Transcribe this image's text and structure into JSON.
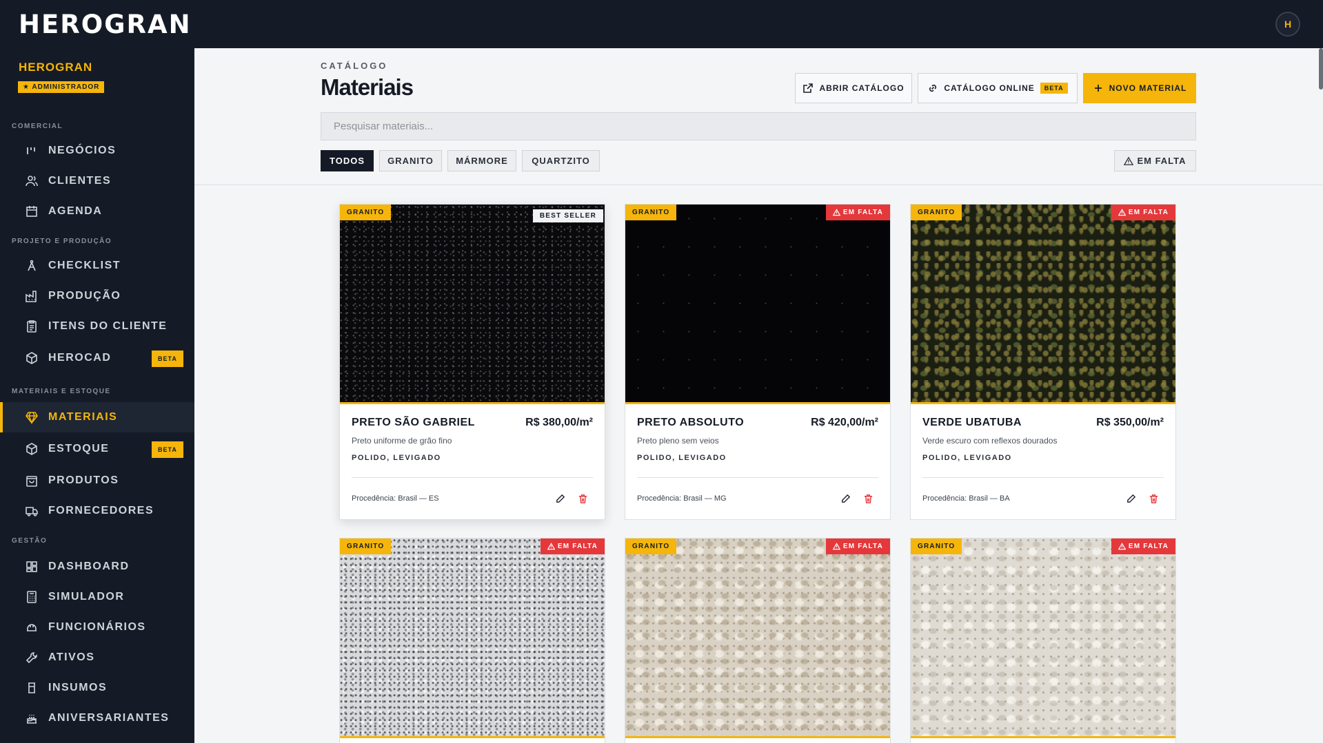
{
  "app": {
    "logo": "HEROGRAN",
    "avatar_initial": "H"
  },
  "sidebar": {
    "org_name": "HEROGRAN",
    "role": "★ ADMINISTRADOR",
    "sections": {
      "comercial": "COMERCIAL",
      "projeto": "PROJETO E PRODUÇÃO",
      "materiais": "MATERIAIS E ESTOQUE",
      "gestao": "GESTÃO"
    },
    "items": [
      {
        "label": "NEGÓCIOS",
        "icon": "chart-bars-icon"
      },
      {
        "label": "CLIENTES",
        "icon": "users-icon"
      },
      {
        "label": "AGENDA",
        "icon": "calendar-icon"
      },
      {
        "label": "CHECKLIST",
        "icon": "compass-icon"
      },
      {
        "label": "PRODUÇÃO",
        "icon": "factory-icon"
      },
      {
        "label": "ITENS DO CLIENTE",
        "icon": "clipboard-icon"
      },
      {
        "label": "HEROCAD",
        "icon": "box-icon",
        "badge": "BETA"
      },
      {
        "label": "MATERIAIS",
        "icon": "gem-icon"
      },
      {
        "label": "ESTOQUE",
        "icon": "box-icon",
        "badge": "BETA"
      },
      {
        "label": "PRODUTOS",
        "icon": "shopping-bag-icon"
      },
      {
        "label": "FORNECEDORES",
        "icon": "truck-icon"
      },
      {
        "label": "DASHBOARD",
        "icon": "dashboard-icon"
      },
      {
        "label": "SIMULADOR",
        "icon": "calculator-icon"
      },
      {
        "label": "FUNCIONÁRIOS",
        "icon": "hard-hat-icon"
      },
      {
        "label": "ATIVOS",
        "icon": "wrench-icon"
      },
      {
        "label": "INSUMOS",
        "icon": "cylinder-icon"
      },
      {
        "label": "ANIVERSARIANTES",
        "icon": "cake-icon"
      }
    ],
    "active_item": "MATERIAIS"
  },
  "header": {
    "eyebrow": "CATÁLOGO",
    "title": "Materiais",
    "btn_open_catalog": "ABRIR CATÁLOGO",
    "btn_online_catalog": "CATÁLOGO ONLINE",
    "btn_online_badge": "BETA",
    "btn_new_material": "NOVO MATERIAL"
  },
  "search": {
    "placeholder": "Pesquisar materiais..."
  },
  "filters": {
    "items": [
      "TODOS",
      "GRANITO",
      "MÁRMORE",
      "QUARTZITO"
    ],
    "active": "TODOS",
    "out_of_stock": "EM FALTA"
  },
  "cards": [
    {
      "category": "GRANITO",
      "right_tag": "BEST SELLER",
      "name": "PRETO SÃO GABRIEL",
      "price": "R$ 380,00/m²",
      "description": "Preto uniforme de grão fino",
      "finish": "POLIDO, LEVIGADO",
      "origin": "Procedência: Brasil — ES",
      "texture": "black-speckled"
    },
    {
      "category": "GRANITO",
      "right_tag": "EM FALTA",
      "name": "PRETO ABSOLUTO",
      "price": "R$ 420,00/m²",
      "description": "Preto pleno sem veios",
      "finish": "POLIDO, LEVIGADO",
      "origin": "Procedência: Brasil — MG",
      "texture": "black-plain"
    },
    {
      "category": "GRANITO",
      "right_tag": "EM FALTA",
      "name": "VERDE UBATUBA",
      "price": "R$ 350,00/m²",
      "description": "Verde escuro com reflexos dourados",
      "finish": "POLIDO, LEVIGADO",
      "origin": "Procedência: Brasil — BA",
      "texture": "green-gold"
    },
    {
      "category": "GRANITO",
      "right_tag": "EM FALTA",
      "texture": "grey-speckled"
    },
    {
      "category": "GRANITO",
      "right_tag": "EM FALTA",
      "texture": "beige"
    },
    {
      "category": "GRANITO",
      "right_tag": "EM FALTA",
      "texture": "cream"
    }
  ],
  "colors": {
    "accent": "#f5b50a",
    "dark": "#151b26",
    "danger": "#e5383b"
  }
}
